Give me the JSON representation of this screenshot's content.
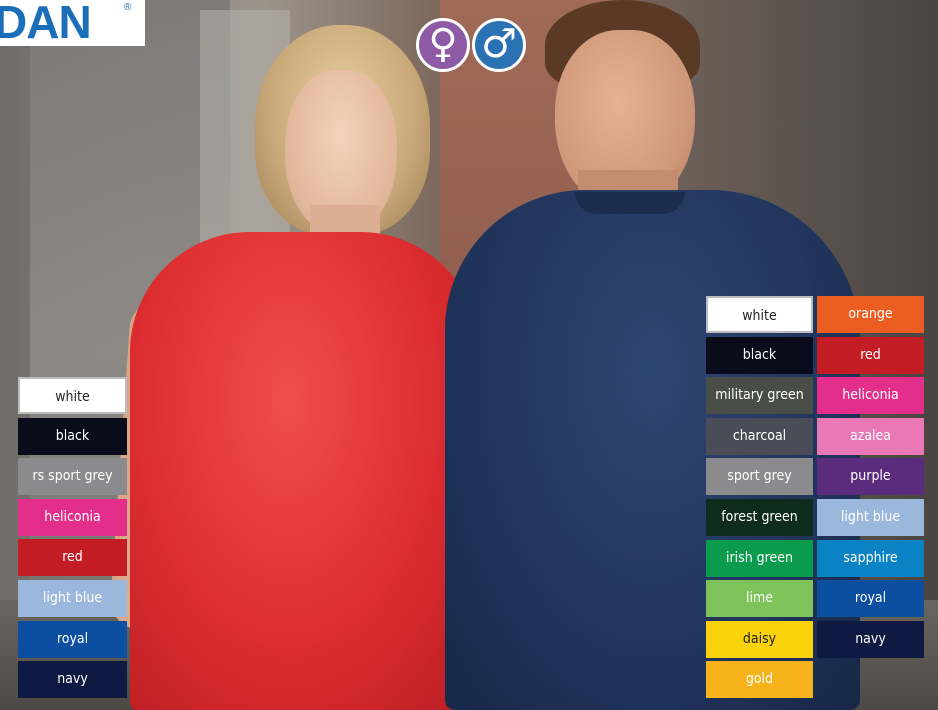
{
  "brand": {
    "logo_text": "DAN",
    "registered_mark": "®",
    "logo_color": "#1a6fb8"
  },
  "gender_icons": {
    "female": {
      "glyph": "♀",
      "color": "#8e5aa6"
    },
    "male": {
      "glyph": "♂",
      "color": "#2b72b5"
    }
  },
  "women_colors": [
    {
      "label": "white",
      "bg": "#ffffff",
      "fg": "#222222"
    },
    {
      "label": "black",
      "bg": "#0a0c1c",
      "fg": "#ffffff"
    },
    {
      "label": "rs sport grey",
      "bg": "#8b8b8d",
      "fg": "#ffffff"
    },
    {
      "label": "heliconia",
      "bg": "#e42e8c",
      "fg": "#ffffff"
    },
    {
      "label": "red",
      "bg": "#c41c24",
      "fg": "#ffffff"
    },
    {
      "label": "light blue",
      "bg": "#9bb8dc",
      "fg": "#ffffff"
    },
    {
      "label": "royal",
      "bg": "#0c4ea0",
      "fg": "#ffffff"
    },
    {
      "label": "navy",
      "bg": "#0e1a42",
      "fg": "#ffffff"
    }
  ],
  "men_colors_left": [
    {
      "label": "white",
      "bg": "#ffffff",
      "fg": "#222222"
    },
    {
      "label": "black",
      "bg": "#0a0c1c",
      "fg": "#ffffff"
    },
    {
      "label": "military green",
      "bg": "#4a4d47",
      "fg": "#ffffff"
    },
    {
      "label": "charcoal",
      "bg": "#4a4d58",
      "fg": "#ffffff"
    },
    {
      "label": "sport grey",
      "bg": "#8b8b8d",
      "fg": "#ffffff"
    },
    {
      "label": "forest green",
      "bg": "#0d2c1e",
      "fg": "#ffffff"
    },
    {
      "label": "irish green",
      "bg": "#0b9b4c",
      "fg": "#ffffff"
    },
    {
      "label": "lime",
      "bg": "#7ec35a",
      "fg": "#ffffff"
    },
    {
      "label": "daisy",
      "bg": "#f9d20c",
      "fg": "#222222"
    },
    {
      "label": "gold",
      "bg": "#f6b21a",
      "fg": "#ffffff"
    }
  ],
  "men_colors_right": [
    {
      "label": "orange",
      "bg": "#ec5d22",
      "fg": "#ffffff"
    },
    {
      "label": "red",
      "bg": "#c41c24",
      "fg": "#ffffff"
    },
    {
      "label": "heliconia",
      "bg": "#e42e8c",
      "fg": "#ffffff"
    },
    {
      "label": "azalea",
      "bg": "#ea77b6",
      "fg": "#ffffff"
    },
    {
      "label": "purple",
      "bg": "#5b2c7e",
      "fg": "#ffffff"
    },
    {
      "label": "light blue",
      "bg": "#9bb8dc",
      "fg": "#ffffff"
    },
    {
      "label": "sapphire",
      "bg": "#0a83c4",
      "fg": "#ffffff"
    },
    {
      "label": "royal",
      "bg": "#0c4ea0",
      "fg": "#ffffff"
    },
    {
      "label": "navy",
      "bg": "#0e1a42",
      "fg": "#ffffff"
    }
  ]
}
